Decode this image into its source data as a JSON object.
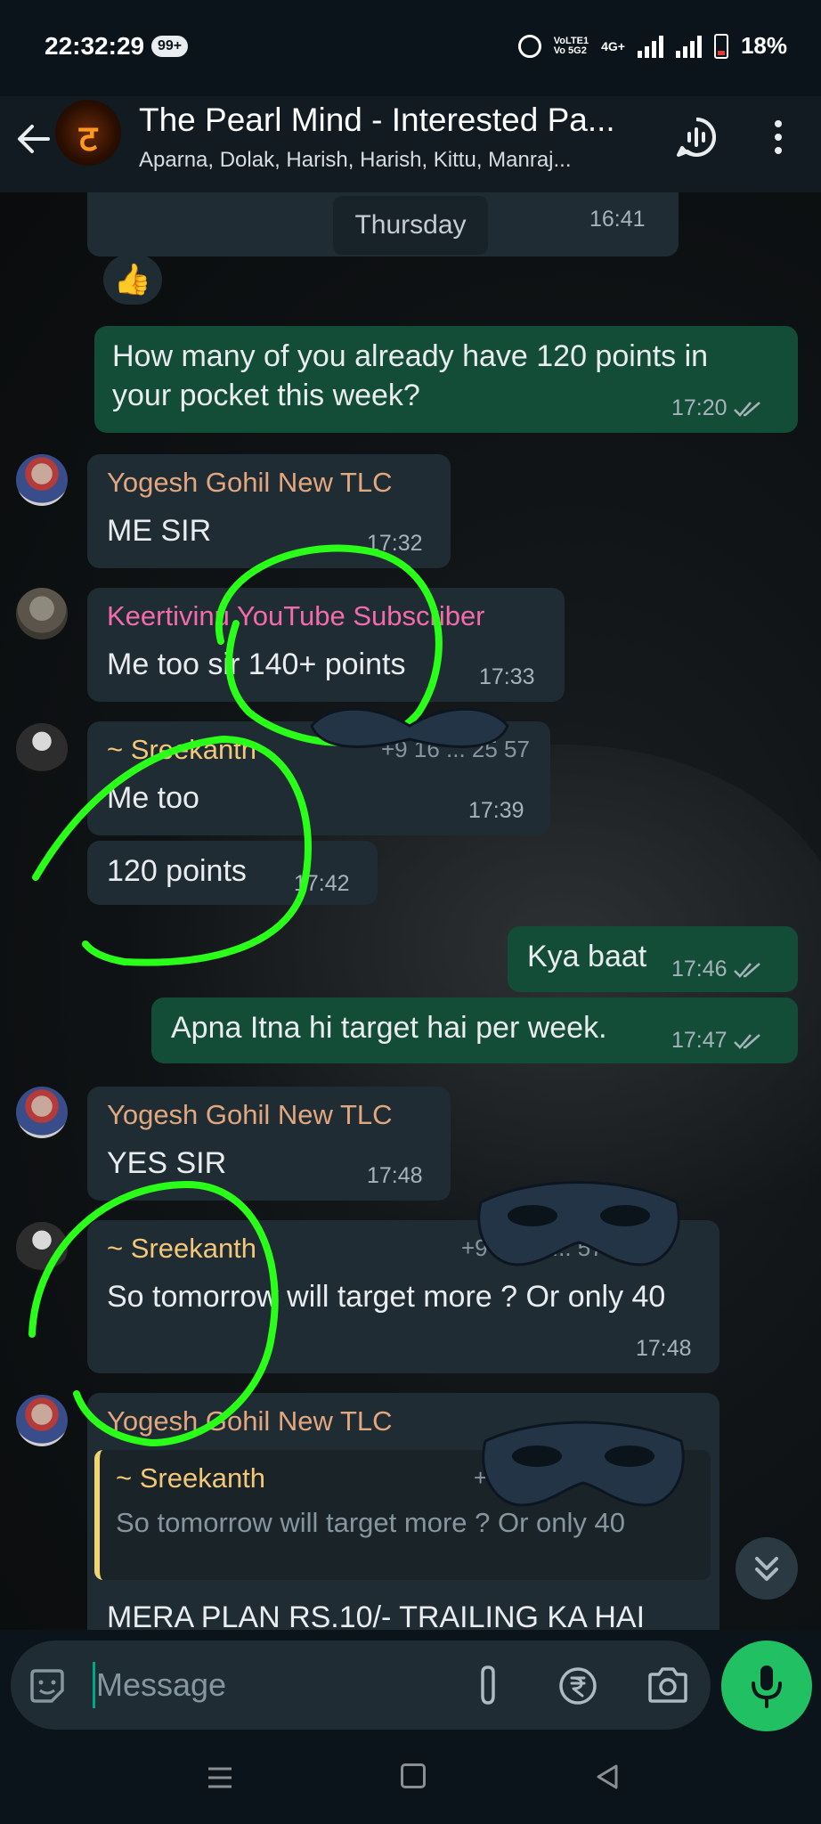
{
  "status_bar": {
    "time": "22:32:29",
    "notification_count": "99+",
    "network_label": "VoLTE1\nVo 5G2",
    "data_label": "4G+",
    "battery": "18%"
  },
  "header": {
    "title": "The Pearl Mind - Interested Pa...",
    "subtitle": "Aparna, Dolak, Harish, Harish, Kittu, Manraj...",
    "avatar_glyph": "ट"
  },
  "chat": {
    "date_chip": "Thursday",
    "date_chip_time": "16:41",
    "reaction": "👍",
    "messages": [
      {
        "dir": "out",
        "text": "How many of you already have 120 points in your pocket this week?",
        "time": "17:20"
      },
      {
        "dir": "in",
        "sender": "Yogesh Gohil New TLC",
        "sender_color": "#e2a77e",
        "text": "ME SIR",
        "time": "17:32"
      },
      {
        "dir": "in",
        "sender": "Keertivinu YouTube Subscriber",
        "sender_color": "#f36bad",
        "text": "Me too sir 140+ points",
        "time": "17:33"
      },
      {
        "dir": "in",
        "sender": "~ Sreekanth",
        "sender_color": "#f2c878",
        "phone": "+9 16 ... 25 57",
        "text": "Me too",
        "time": "17:39"
      },
      {
        "dir": "in",
        "text": "120 points",
        "time": "17:42"
      },
      {
        "dir": "out",
        "text": "Kya baat",
        "time": "17:46"
      },
      {
        "dir": "out",
        "text": "Apna Itna hi target hai per week.",
        "time": "17:47"
      },
      {
        "dir": "in",
        "sender": "Yogesh Gohil New TLC",
        "sender_color": "#e2a77e",
        "text": "YES SIR",
        "time": "17:48"
      },
      {
        "dir": "in",
        "sender": "~ Sreekanth",
        "sender_color": "#f2c878",
        "phone": "+9 ... 18 ... 57",
        "text": "So tomorrow will target more ? Or only 40",
        "time": "17:48"
      },
      {
        "dir": "in",
        "sender": "Yogesh Gohil New TLC",
        "sender_color": "#e2a77e",
        "quote_sender": "~ Sreekanth",
        "quote_phone": "+9 ... 7",
        "quote_text": "So tomorrow will target more ? Or only 40",
        "text": "MERA PLAN RS.10/- TRAILING KA HAI"
      }
    ]
  },
  "input": {
    "placeholder": "Message"
  },
  "colors": {
    "accent_green": "#21c063",
    "outgoing_bubble": "#144d37",
    "incoming_bubble": "#202c33",
    "annotation_green": "#2aff1a",
    "quote_bar": "#f2d374"
  },
  "icons": [
    "back-arrow-icon",
    "voice-chat-icon",
    "more-vert-icon",
    "emoji-icon",
    "attach-icon",
    "rupee-icon",
    "camera-icon",
    "mic-icon",
    "chevron-double-down-icon"
  ]
}
